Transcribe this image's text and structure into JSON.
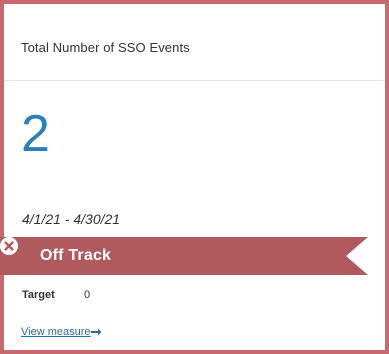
{
  "card": {
    "title": "Total Number of SSO Events",
    "value": "2",
    "date_range": "4/1/21 - 4/30/21",
    "status": {
      "label": "Off Track",
      "icon": "x-circle-icon",
      "color": "#b05a5e"
    },
    "target": {
      "label": "Target",
      "value": "0"
    },
    "link": {
      "label": "View measure",
      "icon": "arrow-right-icon"
    }
  },
  "colors": {
    "accent": "#2a80b9",
    "border": "#c8696f",
    "ribbon": "#b05a5e"
  }
}
